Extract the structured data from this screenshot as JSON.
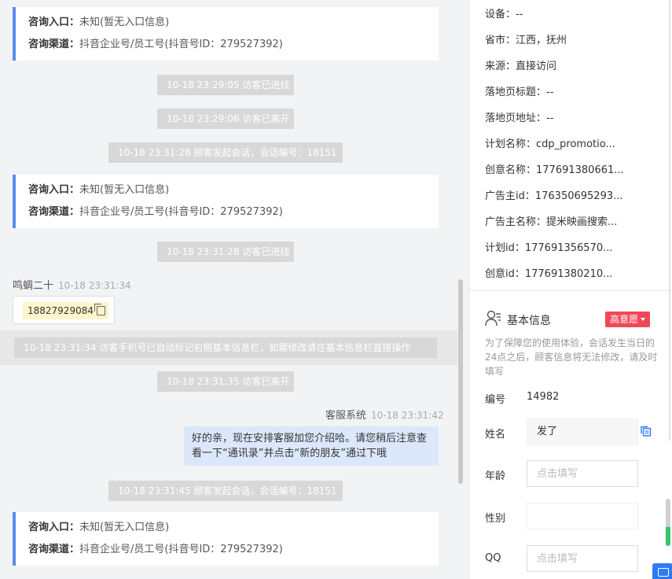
{
  "chat": {
    "card_labels": {
      "entry": "咨询入口：",
      "channel": "咨询渠道："
    },
    "cards": [
      {
        "entry": "未知(暂无入口信息)",
        "channel": "抖音企业号/员工号(抖音号ID：279527392)"
      },
      {
        "entry": "未知(暂无入口信息)",
        "channel": "抖音企业号/员工号(抖音号ID：279527392)"
      },
      {
        "entry": "未知(暂无入口信息)",
        "channel": "抖音企业号/员工号(抖音号ID：279527392)"
      }
    ],
    "system_messages": [
      "10-18 23:29:05 访客已进线",
      "10-18 23:29:06 访客已离开",
      "10-18 23:31:28 顾客发起会话，会话编号：18151",
      "10-18 23:31:28 访客已进线",
      "10-18 23:31:34 访客手机号已自动标记右侧基本信息栏，如需修改请在基本信息栏直接操作",
      "10-18 23:31:35 访客已离开",
      "10-18 23:31:45 顾客发起会话，会话编号：18151"
    ],
    "visitor": {
      "name": "鸣蜩二十",
      "time": "10-18 23:31:34",
      "phone": "18827929084"
    },
    "agent": {
      "name": "客服系统",
      "time": "10-18 23:31:42",
      "message": "好的亲，现在安排客服加您介绍哈。请您稍后注意查看一下“通讯录”并点击“新的朋友”通过下哦"
    }
  },
  "side": {
    "details": [
      "设备：--",
      "省市：江西，抚州",
      "来源：直接访问",
      "落地页标题：--",
      "落地页地址：--",
      "计划名称：cdp_promotio...",
      "创意名称：177691380661...",
      "广告主id：176350695293...",
      "广告主名称：提米映画搜索...",
      "计划id：177691356570...",
      "创意id：177691380210..."
    ],
    "basic_info": {
      "title": "基本信息",
      "badge": "高意愿",
      "hint": "为了保障您的使用体验，会话发生当日的24点之后，顾客信息将无法修改，请及时填写",
      "fields": {
        "id_label": "编号",
        "id_value": "14982",
        "name_label": "姓名",
        "name_value": "发了",
        "age_label": "年龄",
        "age_placeholder": "点击填写",
        "gender_label": "性别",
        "qq_label": "QQ",
        "qq_placeholder": "点击填写"
      }
    }
  },
  "colors": {
    "accent": "#5b8def",
    "badge": "#f0485a",
    "reply_bubble": "#dbe8fb",
    "system_pill": "#d8d8d8"
  }
}
